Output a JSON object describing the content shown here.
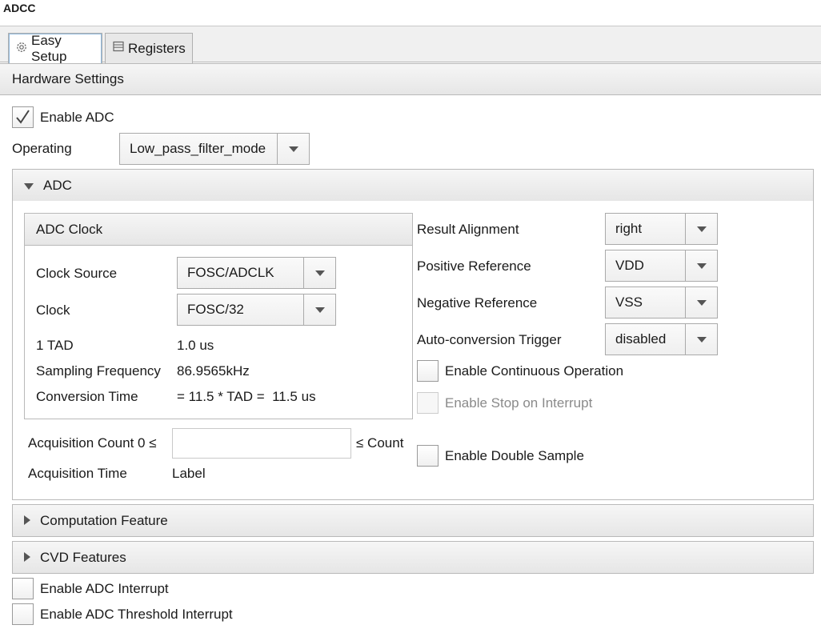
{
  "app": {
    "title": "ADCC"
  },
  "tabs": [
    {
      "label": "Easy Setup",
      "icon": "gear-icon",
      "active": true
    },
    {
      "label": "Registers",
      "icon": "register-list-icon",
      "active": false
    }
  ],
  "hardware": {
    "title": "Hardware Settings",
    "enable_adc": {
      "label": "Enable ADC",
      "checked": true
    },
    "operating": {
      "label": "Operating",
      "value": "Low_pass_filter_mode"
    }
  },
  "adc": {
    "title": "ADC",
    "expanded": true,
    "clock": {
      "title": "ADC Clock",
      "clock_source": {
        "label": "Clock Source",
        "value": "FOSC/ADCLK"
      },
      "clock": {
        "label": "Clock",
        "value": "FOSC/32"
      },
      "tad": {
        "label": "1 TAD",
        "value": "1.0 us"
      },
      "sampling": {
        "label": "Sampling Frequency",
        "value": "86.9565kHz"
      },
      "conversion": {
        "label": "Conversion Time",
        "value": "= 11.5 * TAD =  11.5 us"
      }
    },
    "acquisition_count": {
      "label": "Acquisition Count 0 ≤",
      "suffix": "≤ Count",
      "value": ""
    },
    "acquisition_time": {
      "label": "Acquisition Time",
      "value": "Label"
    },
    "result_alignment": {
      "label": "Result Alignment",
      "value": "right"
    },
    "positive_reference": {
      "label": "Positive Reference",
      "value": "VDD"
    },
    "negative_reference": {
      "label": "Negative Reference",
      "value": "VSS"
    },
    "auto_trigger": {
      "label": "Auto-conversion Trigger",
      "value": "disabled"
    },
    "continuous": {
      "label": "Enable Continuous Operation",
      "checked": false
    },
    "stop_on_interrupt": {
      "label": "Enable Stop on Interrupt",
      "checked": false,
      "disabled": true
    },
    "double_sample": {
      "label": "Enable Double Sample",
      "checked": false
    }
  },
  "computation": {
    "title": "Computation Feature",
    "expanded": false
  },
  "cvd": {
    "title": "CVD Features",
    "expanded": false
  },
  "interrupts": {
    "adc_interrupt": {
      "label": "Enable ADC Interrupt",
      "checked": false
    },
    "threshold_interrupt": {
      "label": "Enable ADC Threshold Interrupt",
      "checked": false
    }
  }
}
